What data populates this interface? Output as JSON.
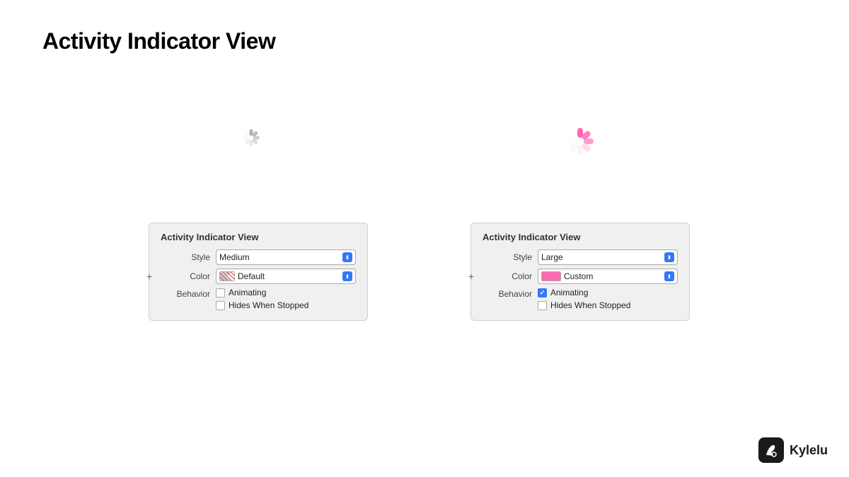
{
  "page": {
    "title": "Activity Indicator View",
    "background": "#ffffff"
  },
  "branding": {
    "name": "Kylelu",
    "logo_symbol": "🖊"
  },
  "left_panel": {
    "title": "Activity Indicator View",
    "style_label": "Style",
    "style_value": "Medium",
    "color_label": "Color",
    "color_value": "Default",
    "behavior_label": "Behavior",
    "animating_label": "Animating",
    "animating_checked": false,
    "hides_when_stopped_label": "Hides When Stopped",
    "hides_when_stopped_checked": false,
    "plus_label": "+"
  },
  "right_panel": {
    "title": "Activity Indicator View",
    "style_label": "Style",
    "style_value": "Large",
    "color_label": "Color",
    "color_value": "Custom",
    "behavior_label": "Behavior",
    "animating_label": "Animating",
    "animating_checked": true,
    "hides_when_stopped_label": "Hides When Stopped",
    "hides_when_stopped_checked": false,
    "plus_label": "+"
  }
}
